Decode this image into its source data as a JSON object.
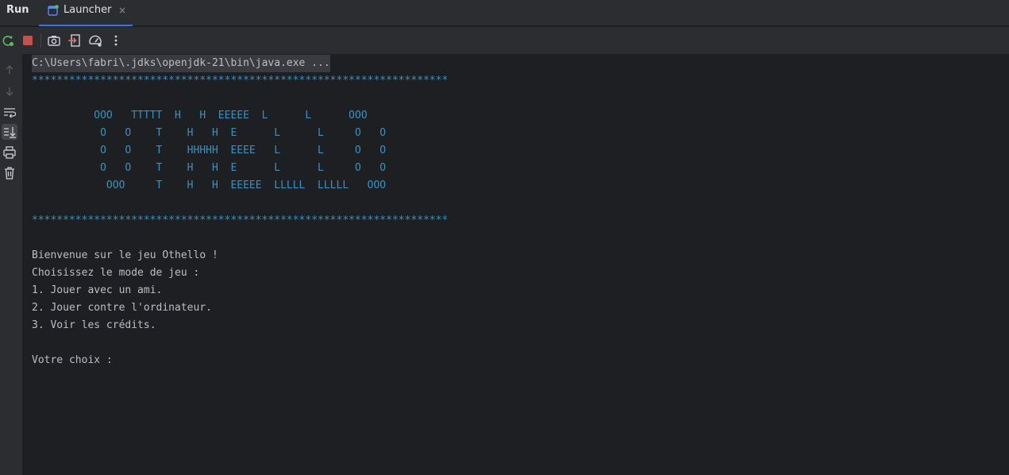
{
  "run_panel": {
    "title": "Run",
    "tab": {
      "label": "Launcher",
      "close_glyph": "×",
      "icon": "application-run-icon"
    }
  },
  "toolbar": {
    "buttons": [
      {
        "name": "rerun-button",
        "icon": "rerun-icon"
      },
      {
        "name": "stop-button",
        "icon": "stop-icon"
      },
      {
        "name": "screenshot-button",
        "icon": "camera-icon"
      },
      {
        "name": "exit-button",
        "icon": "exit-icon"
      },
      {
        "name": "profiler-button",
        "icon": "speedometer-icon"
      },
      {
        "name": "more-options-button",
        "icon": "more-vertical-icon"
      }
    ]
  },
  "sidebar": {
    "buttons": [
      {
        "name": "up-button",
        "icon": "arrow-up-icon"
      },
      {
        "name": "down-button",
        "icon": "arrow-down-icon"
      },
      {
        "name": "soft-wrap-button",
        "icon": "soft-wrap-icon"
      },
      {
        "name": "scroll-to-end-button",
        "icon": "scroll-to-end-icon"
      },
      {
        "name": "print-button",
        "icon": "printer-icon"
      },
      {
        "name": "clear-all-button",
        "icon": "trash-icon"
      }
    ]
  },
  "console": {
    "command": "C:\\Users\\fabri\\.jdks\\openjdk-21\\bin\\java.exe ...",
    "stars": "*******************************************************************",
    "banner": [
      "          OOO   TTTTT  H   H  EEEEE  L      L      OOO",
      "           O   O    T    H   H  E      L      L     O   O",
      "           O   O    T    HHHHH  EEEE   L      L     O   O",
      "           O   O    T    H   H  E      L      L     O   O",
      "            OOO     T    H   H  EEEEE  LLLLL  LLLLL   OOO"
    ],
    "welcome": "Bienvenue sur le jeu Othello !",
    "prompt_mode": "Choisissez le mode de jeu :",
    "options": [
      "1. Jouer avec un ami.",
      "2. Jouer contre l'ordinateur.",
      "3. Voir les crédits."
    ],
    "choice_prompt": "Votre choix :"
  },
  "colors": {
    "background": "#1e1f22",
    "panel": "#2b2d30",
    "text": "#bcbec4",
    "ascii_art": "#3592c4",
    "accent": "#3574f0",
    "stop": "#c94f4f",
    "rerun": "#5fb865"
  }
}
